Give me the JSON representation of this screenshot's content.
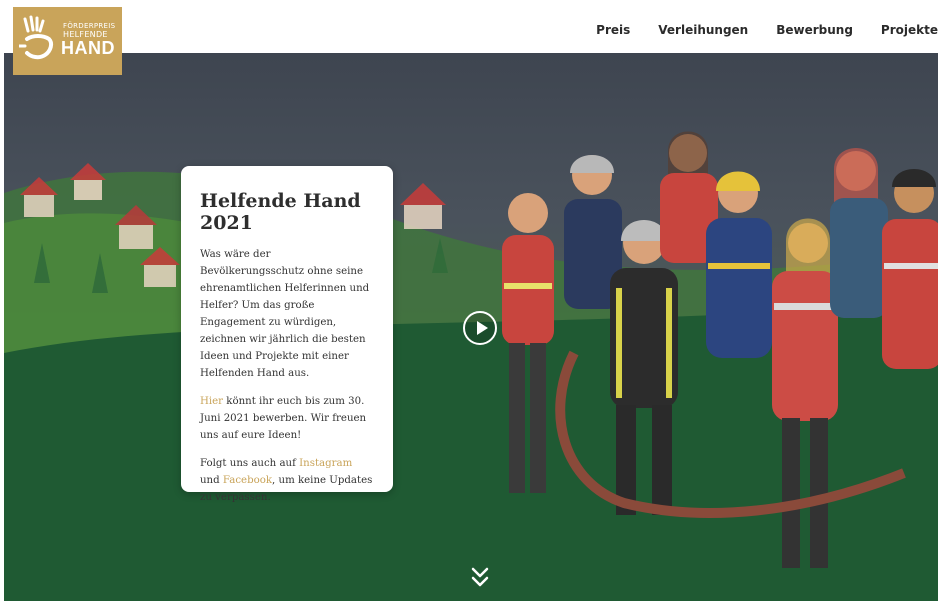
{
  "logo": {
    "line1": "FÖRDERPREIS",
    "line2": "HELFENDE",
    "line3": "HAND",
    "icon": "hand-icon",
    "color": "#c9a45a"
  },
  "nav": {
    "items": [
      "Preis",
      "Verleihungen",
      "Bewerbung",
      "Projekte"
    ]
  },
  "hero": {
    "play_icon": "play-icon",
    "scroll_icon": "chevron-double-down-icon"
  },
  "card": {
    "title": "Helfende Hand 2021",
    "p1": "Was wäre der Bevölkerungsschutz ohne seine ehrenamtlichen Helferinnen und Helfer? Um das große Engagement zu würdigen, zeichnen wir jährlich die besten Ideen und Projekte mit einer Helfenden Hand aus.",
    "p2_link": "Hier",
    "p2_text": " könnt ihr euch bis zum 30. Juni 2021 bewerben. Wir freuen uns auf eure Ideen!",
    "p3_pre": "Folgt uns auch auf ",
    "p3_link1": "Instagram",
    "p3_mid": " und ",
    "p3_link2": "Facebook",
    "p3_post": ", um keine Updates zu verpassen.",
    "link_color": "#c9a45a"
  }
}
